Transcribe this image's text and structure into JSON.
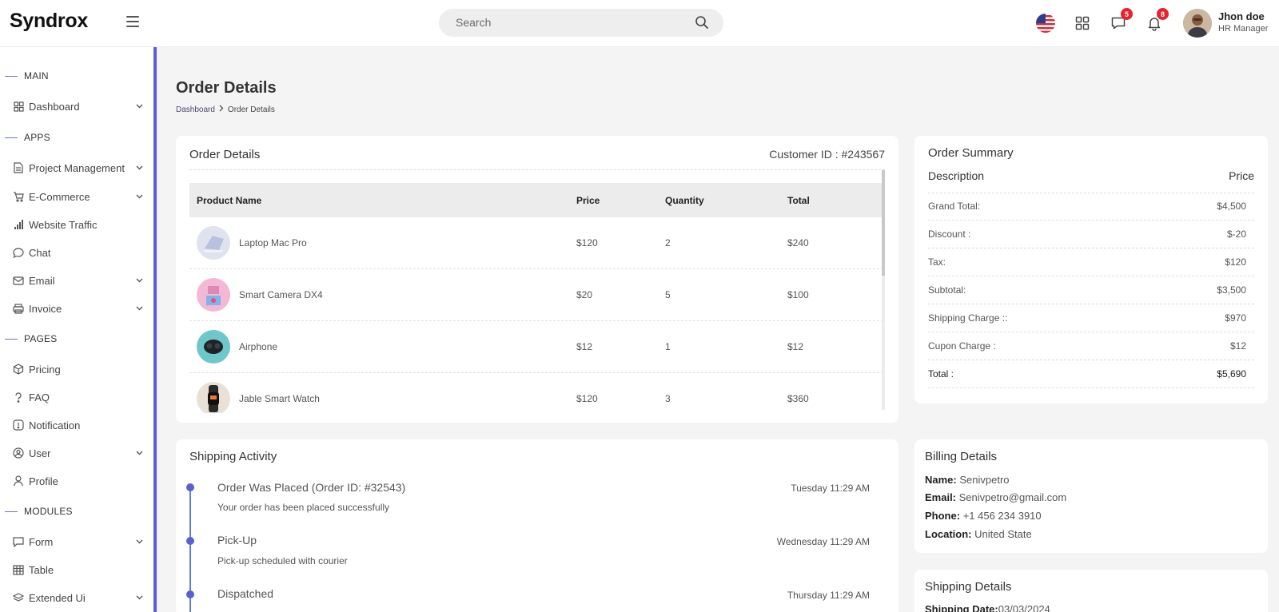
{
  "app": {
    "logo": "Syndrox"
  },
  "header": {
    "search_placeholder": "Search",
    "messages_badge": "5",
    "notifications_badge": "8",
    "user_name": "Jhon doe",
    "user_role": "HR Manager"
  },
  "sidebar": {
    "sections": {
      "main": "MAIN",
      "apps": "APPS",
      "pages": "PAGES",
      "modules": "MODULES"
    },
    "items": [
      {
        "label": "Dashboard",
        "icon": "grid-icon"
      },
      {
        "label": "Project Management",
        "icon": "document-icon"
      },
      {
        "label": "E-Commerce",
        "icon": "cart-icon"
      },
      {
        "label": "Website Traffic",
        "icon": "bar-signal-icon"
      },
      {
        "label": "Chat",
        "icon": "chat-bubble-icon"
      },
      {
        "label": "Email",
        "icon": "mail-icon"
      },
      {
        "label": "Invoice",
        "icon": "printer-icon"
      },
      {
        "label": "Pricing",
        "icon": "cube-icon"
      },
      {
        "label": "FAQ",
        "icon": "question-icon"
      },
      {
        "label": "Notification",
        "icon": "alert-icon"
      },
      {
        "label": "User",
        "icon": "user-circle-icon"
      },
      {
        "label": "Profile",
        "icon": "person-icon"
      },
      {
        "label": "Form",
        "icon": "form-icon"
      },
      {
        "label": "Table",
        "icon": "table-icon"
      },
      {
        "label": "Extended Ui",
        "icon": "layers-icon"
      }
    ]
  },
  "page": {
    "title": "Order Details",
    "breadcrumb": {
      "parent": "Dashboard",
      "current": "Order Details"
    }
  },
  "order": {
    "title": "Order Details",
    "customer_id": "Customer ID : #243567",
    "columns": {
      "product": "Product Name",
      "price": "Price",
      "quantity": "Quantity",
      "total": "Total"
    },
    "rows": [
      {
        "name": "Laptop Mac Pro",
        "price": "$120",
        "qty": "2",
        "total": "$240"
      },
      {
        "name": "Smart Camera DX4",
        "price": "$20",
        "qty": "5",
        "total": "$100"
      },
      {
        "name": "Airphone",
        "price": "$12",
        "qty": "1",
        "total": "$12"
      },
      {
        "name": "Jable Smart Watch",
        "price": "$120",
        "qty": "3",
        "total": "$360"
      }
    ]
  },
  "summary": {
    "title": "Order Summary",
    "desc_header": "Description",
    "price_header": "Price",
    "rows": [
      {
        "label": "Grand Total:",
        "value": "$4,500"
      },
      {
        "label": "Discount :",
        "value": "$-20"
      },
      {
        "label": "Tax:",
        "value": "$120"
      },
      {
        "label": "Subtotal:",
        "value": "$3,500"
      },
      {
        "label": "Shipping Charge ::",
        "value": "$970"
      },
      {
        "label": "Cupon Charge :",
        "value": "$12"
      },
      {
        "label": "Total :",
        "value": "$5,690"
      }
    ]
  },
  "shipping_activity": {
    "title": "Shipping Activity",
    "events": [
      {
        "title": "Order Was Placed (Order ID: #32543)",
        "sub": "Your order has been placed successfully",
        "time": "Tuesday 11:29 AM"
      },
      {
        "title": "Pick-Up",
        "sub": "Pick-up scheduled with courier",
        "time": "Wednesday 11:29 AM"
      },
      {
        "title": "Dispatched",
        "sub": "",
        "time": "Thursday 11:29 AM"
      }
    ]
  },
  "billing": {
    "title": "Billing Details",
    "name_label": "Name:",
    "name": "Senivpetro",
    "email_label": "Email:",
    "email": "Senivpetro@gmail.com",
    "phone_label": "Phone:",
    "phone": "+1 456 234 3910",
    "location_label": "Location:",
    "location": "United State"
  },
  "shipping_details": {
    "title": "Shipping Details",
    "date_label": "Shipping Date:",
    "date": "03/03/2024"
  },
  "colors": {
    "accent": "#5b5fd6",
    "badge": "#e8212b",
    "timeline": "#5b7fe0"
  }
}
